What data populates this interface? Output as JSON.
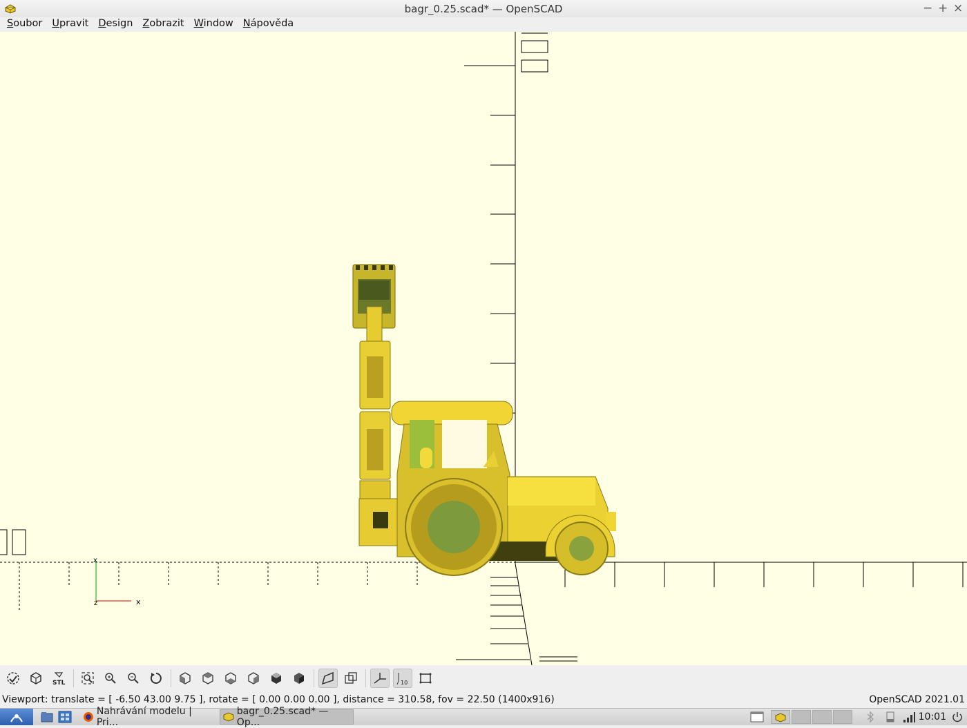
{
  "window": {
    "title": "bagr_0.25.scad* — OpenSCAD",
    "controls": [
      "−",
      "+",
      "×"
    ]
  },
  "menu": [
    "Soubor",
    "Upravit",
    "Design",
    "Zobrazit",
    "Window",
    "Nápověda"
  ],
  "viewport": {
    "background": "#ffffe5",
    "model_color": "#f0d535",
    "axis_labels": {
      "x": "x",
      "z": "z"
    }
  },
  "toolbar": {
    "buttons": [
      {
        "name": "preview-icon",
        "label": ""
      },
      {
        "name": "render-icon",
        "label": ""
      },
      {
        "name": "export-stl-icon",
        "label": "STL"
      },
      {
        "name": "view-all-icon",
        "label": ""
      },
      {
        "name": "zoom-in-icon",
        "label": ""
      },
      {
        "name": "zoom-out-icon",
        "label": ""
      },
      {
        "name": "reset-view-icon",
        "label": ""
      },
      {
        "name": "view-right-icon",
        "label": ""
      },
      {
        "name": "view-top-icon",
        "label": ""
      },
      {
        "name": "view-bottom-icon",
        "label": ""
      },
      {
        "name": "view-left-icon",
        "label": ""
      },
      {
        "name": "view-front-icon",
        "label": ""
      },
      {
        "name": "view-back-icon",
        "label": ""
      },
      {
        "name": "perspective-icon",
        "label": ""
      },
      {
        "name": "orthogonal-icon",
        "label": ""
      },
      {
        "name": "show-axes-icon",
        "label": ""
      },
      {
        "name": "show-scale-icon",
        "label": "10"
      },
      {
        "name": "show-edges-icon",
        "label": ""
      }
    ]
  },
  "status": {
    "viewport_info": "Viewport: translate = [ -6.50 43.00 9.75 ], rotate = [ 0.00 0.00 0.00 ], distance = 310.58, fov = 22.50 (1400x916)",
    "version": "OpenSCAD 2021.01"
  },
  "taskbar": {
    "tasks": [
      {
        "label": "Nahrávání modelu | Pri...",
        "active": false
      },
      {
        "label": "bagr_0.25.scad* — Op...",
        "active": true
      }
    ],
    "clock": "10:01"
  }
}
